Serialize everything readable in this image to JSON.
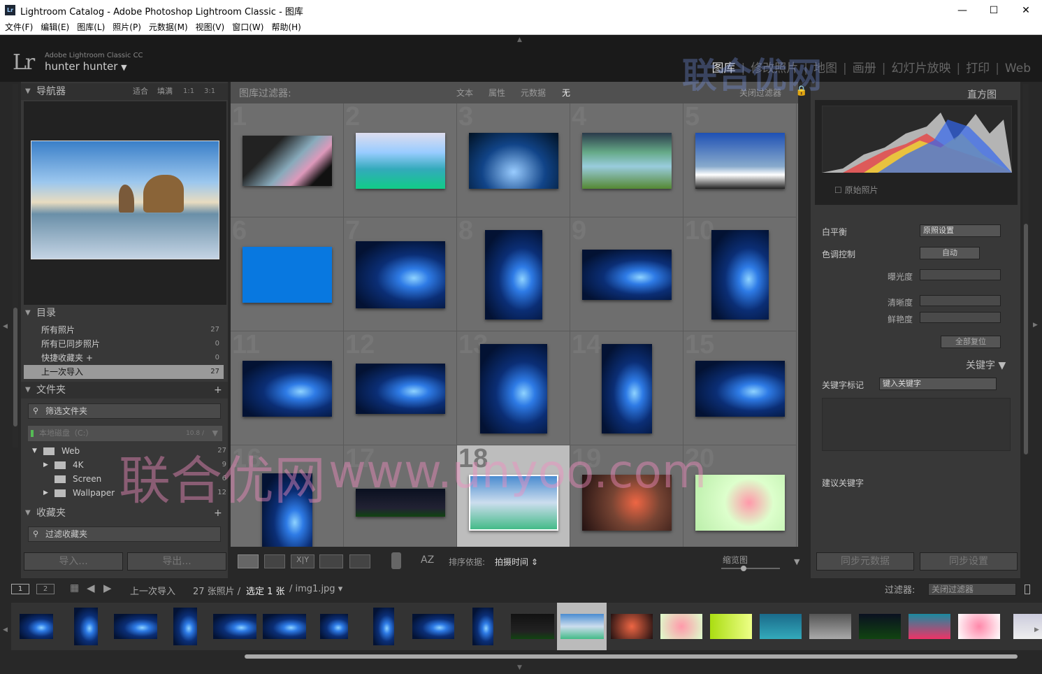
{
  "window": {
    "title": "Lightroom Catalog - Adobe Photoshop Lightroom Classic - 图库",
    "lr_badge": "Lr"
  },
  "menu": [
    "文件(F)",
    "编辑(E)",
    "图库(L)",
    "照片(P)",
    "元数据(M)",
    "视图(V)",
    "窗口(W)",
    "帮助(H)"
  ],
  "identity": {
    "logo": "Lr",
    "product": "Adobe Lightroom Classic CC",
    "user": "hunter hunter"
  },
  "modules": [
    {
      "label": "图库",
      "active": true
    },
    {
      "label": "修改照片"
    },
    {
      "label": "地图"
    },
    {
      "label": "画册"
    },
    {
      "label": "幻灯片放映"
    },
    {
      "label": "打印"
    },
    {
      "label": "Web"
    }
  ],
  "navigator": {
    "title": "导航器",
    "zoom": [
      "适合",
      "填满",
      "1:1",
      "3:1"
    ]
  },
  "catalog": {
    "title": "目录",
    "items": [
      {
        "label": "所有照片",
        "count": "27"
      },
      {
        "label": "所有已同步照片",
        "count": "0"
      },
      {
        "label": "快捷收藏夹 +",
        "count": "0"
      },
      {
        "label": "上一次导入",
        "count": "27",
        "selected": true
      }
    ]
  },
  "folders": {
    "title": "文件夹",
    "filter": "筛选文件夹",
    "volume": "本地磁盘（C:）",
    "volume_size": "10.8 /",
    "items": [
      {
        "label": "Web",
        "count": "27"
      },
      {
        "label": "4K",
        "count": "9"
      },
      {
        "label": "Screen",
        "count": "6"
      },
      {
        "label": "Wallpaper",
        "count": "12"
      }
    ]
  },
  "collections": {
    "title": "收藏夹",
    "filter": "过滤收藏夹"
  },
  "left_buttons": {
    "import": "导入...",
    "export": "导出..."
  },
  "filterbar": {
    "title": "图库过滤器:",
    "options": [
      "文本",
      "属性",
      "元数据",
      "无"
    ],
    "preset": "关闭过滤器"
  },
  "grid": {
    "cells": [
      "1",
      "2",
      "3",
      "4",
      "5",
      "6",
      "7",
      "8",
      "9",
      "10",
      "11",
      "12",
      "13",
      "14",
      "15",
      "16",
      "17",
      "18",
      "19",
      "20"
    ],
    "selected": "18"
  },
  "toolbar": {
    "sort_label": "排序依据:",
    "sort_value": "拍摄时间",
    "thumb_label": "缩览图"
  },
  "histogram": {
    "title": "直方图",
    "original": "原始照片"
  },
  "quick_develop": {
    "white_balance": "白平衡",
    "wb_value": "原照设置",
    "tone": "色调控制",
    "auto": "自动",
    "exposure": "曝光度",
    "clarity": "清晰度",
    "vibrance": "鲜艳度",
    "reset": "全部复位"
  },
  "keywords": {
    "title": "关键字",
    "tagging": "关键字标记",
    "input": "键入关键字",
    "suggested": "建议关键字"
  },
  "right_buttons": {
    "sync_meta": "同步元数据",
    "sync_settings": "同步设置"
  },
  "filmstrip": {
    "source": "上一次导入",
    "count": "27 张照片 /",
    "selected": "选定 1 张",
    "file": "/ img1.jpg",
    "filter_label": "过滤器:",
    "filter_value": "关闭过滤器",
    "pages": [
      "1",
      "2"
    ]
  },
  "watermark": {
    "text1": "联合优网",
    "text2": "www.unyoo.com"
  }
}
